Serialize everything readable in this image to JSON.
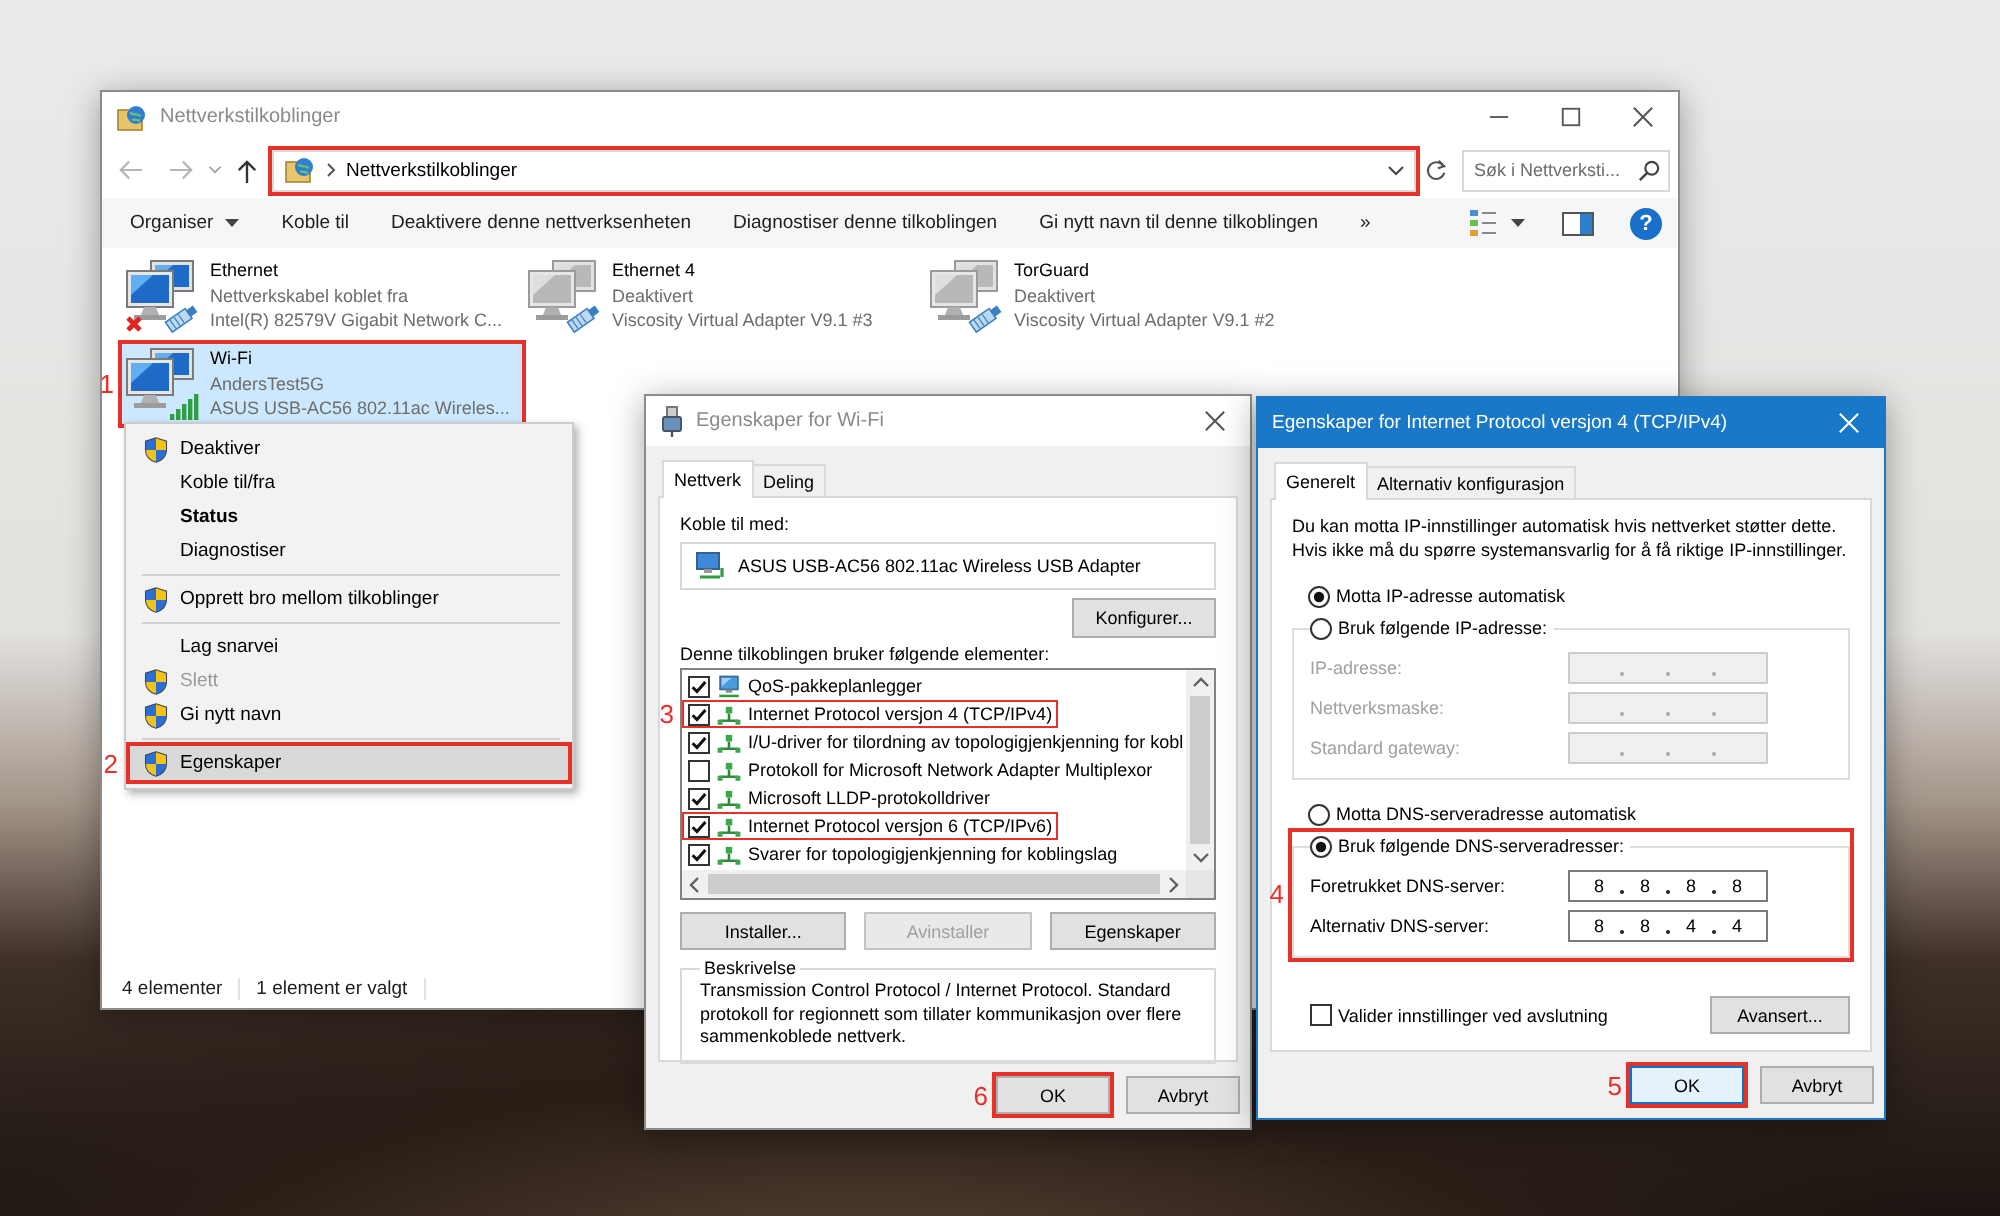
{
  "explorer": {
    "title": "Nettverkstilkoblinger",
    "active": false,
    "address": {
      "path": "Nettverkstilkoblinger",
      "highlighted": true
    },
    "search": {
      "placeholder": "Søk i Nettverksti..."
    },
    "toolbar": [
      {
        "label": "Organiser",
        "kind": "menu"
      },
      {
        "label": "Koble til",
        "kind": "command"
      },
      {
        "label": "Deaktivere denne nettverksenheten",
        "kind": "command"
      },
      {
        "label": "Diagnostiser denne tilkoblingen",
        "kind": "command"
      },
      {
        "label": "Gi nytt navn til denne tilkoblingen",
        "kind": "command"
      },
      {
        "label": "»",
        "kind": "command"
      }
    ],
    "help": "?",
    "connections": [
      {
        "name": "Ethernet",
        "status": "Nettverkskabel koblet fra",
        "device": "Intel(R) 82579V Gigabit Network C...",
        "kind": "wired",
        "disabled": false,
        "unplugged": true,
        "selected": false,
        "highlighted": false
      },
      {
        "name": "Ethernet 4",
        "status": "Deaktivert",
        "device": "Viscosity Virtual Adapter V9.1 #3",
        "kind": "wired",
        "disabled": true,
        "unplugged": false,
        "selected": false,
        "highlighted": false
      },
      {
        "name": "TorGuard",
        "status": "Deaktivert",
        "device": "Viscosity Virtual Adapter V9.1 #2",
        "kind": "wired",
        "disabled": true,
        "unplugged": false,
        "selected": false,
        "highlighted": false
      },
      {
        "name": "Wi-Fi",
        "status": "AndersTest5G",
        "device": "ASUS USB-AC56 802.11ac Wireles...",
        "kind": "wireless",
        "disabled": false,
        "unplugged": false,
        "selected": true,
        "highlighted": true,
        "step": "1"
      }
    ],
    "status_bar": [
      "4 elementer",
      "1 element er valgt"
    ]
  },
  "context_menu": {
    "items": [
      {
        "kind": "item",
        "label": "Deaktiver",
        "shield": true,
        "default": false,
        "disabled": false,
        "selected": false,
        "highlighted": false
      },
      {
        "kind": "item",
        "label": "Koble til/fra",
        "shield": false,
        "default": false,
        "disabled": false,
        "selected": false,
        "highlighted": false
      },
      {
        "kind": "item",
        "label": "Status",
        "shield": false,
        "default": true,
        "disabled": false,
        "selected": false,
        "highlighted": false
      },
      {
        "kind": "item",
        "label": "Diagnostiser",
        "shield": false,
        "default": false,
        "disabled": false,
        "selected": false,
        "highlighted": false
      },
      {
        "kind": "separator"
      },
      {
        "kind": "item",
        "label": "Opprett bro mellom tilkoblinger",
        "shield": true,
        "default": false,
        "disabled": false,
        "selected": false,
        "highlighted": false
      },
      {
        "kind": "separator"
      },
      {
        "kind": "item",
        "label": "Lag snarvei",
        "shield": false,
        "default": false,
        "disabled": false,
        "selected": false,
        "highlighted": false
      },
      {
        "kind": "item",
        "label": "Slett",
        "shield": true,
        "default": false,
        "disabled": true,
        "selected": false,
        "highlighted": false
      },
      {
        "kind": "item",
        "label": "Gi nytt navn",
        "shield": true,
        "default": false,
        "disabled": false,
        "selected": false,
        "highlighted": false
      },
      {
        "kind": "separator"
      },
      {
        "kind": "item",
        "label": "Egenskaper",
        "shield": true,
        "default": false,
        "disabled": false,
        "selected": true,
        "highlighted": true,
        "step": "2"
      }
    ]
  },
  "wifi_dialog": {
    "title": "Egenskaper for Wi-Fi",
    "active": false,
    "tabs": [
      {
        "label": "Nettverk",
        "selected": true
      },
      {
        "label": "Deling",
        "selected": false
      }
    ],
    "connect_label": "Koble til med:",
    "adapter": "ASUS USB-AC56 802.11ac Wireless USB Adapter",
    "configure_button": "Konfigurer...",
    "items_label": "Denne tilkoblingen bruker følgende elementer:",
    "items": [
      {
        "label": "QoS-pakkeplanlegger",
        "kind": "service",
        "checked": true,
        "highlighted": false
      },
      {
        "label": "Internet Protocol versjon 4 (TCP/IPv4)",
        "kind": "protocol",
        "checked": true,
        "highlighted": true,
        "step": "3"
      },
      {
        "label": "I/U-driver for tilordning av topologigjenkjenning for kobl",
        "kind": "protocol",
        "checked": true,
        "highlighted": false
      },
      {
        "label": "Protokoll for Microsoft Network Adapter Multiplexor",
        "kind": "protocol",
        "checked": false,
        "highlighted": false
      },
      {
        "label": "Microsoft LLDP-protokolldriver",
        "kind": "protocol",
        "checked": true,
        "highlighted": false
      },
      {
        "label": "Internet Protocol versjon 6 (TCP/IPv6)",
        "kind": "protocol",
        "checked": true,
        "highlighted": true
      },
      {
        "label": "Svarer for topologigjenkjenning for koblingslag",
        "kind": "protocol",
        "checked": true,
        "highlighted": false
      }
    ],
    "item_buttons": [
      {
        "label": "Installer...",
        "disabled": false
      },
      {
        "label": "Avinstaller",
        "disabled": true
      },
      {
        "label": "Egenskaper",
        "disabled": false
      }
    ],
    "description": {
      "title": "Beskrivelse",
      "text": "Transmission Control Protocol / Internet Protocol. Standard protokoll for regionnett som tillater kommunikasjon over flere sammenkoblede nettverk."
    },
    "buttons": [
      {
        "label": "OK",
        "focused": false,
        "highlighted": true,
        "step": "6"
      },
      {
        "label": "Avbryt",
        "focused": false,
        "highlighted": false
      }
    ]
  },
  "ipv4_dialog": {
    "title": "Egenskaper for Internet Protocol versjon 4 (TCP/IPv4)",
    "active": true,
    "tabs": [
      {
        "label": "Generelt",
        "selected": true
      },
      {
        "label": "Alternativ konfigurasjon",
        "selected": false
      }
    ],
    "intro": "Du kan motta IP-innstillinger automatisk hvis nettverket støtter dette. Hvis ikke må du spørre systemansvarlig for å få riktige IP-innstillinger.",
    "ip_options": [
      {
        "label": "Motta IP-adresse automatisk",
        "selected": true
      },
      {
        "label": "Bruk følgende IP-adresse:",
        "selected": false
      }
    ],
    "ip_fields": [
      {
        "label": "IP-adresse:",
        "disabled": true
      },
      {
        "label": "Nettverksmaske:",
        "disabled": true
      },
      {
        "label": "Standard gateway:",
        "disabled": true
      }
    ],
    "dns_options": [
      {
        "label": "Motta DNS-serveradresse automatisk",
        "selected": false
      },
      {
        "label": "Bruk følgende DNS-serveradresser:",
        "selected": true
      }
    ],
    "dns_group": {
      "highlighted": true,
      "step": "4"
    },
    "dns_fields": [
      {
        "label": "Foretrukket DNS-server:",
        "octets": [
          "8",
          "8",
          "8",
          "8"
        ],
        "disabled": false
      },
      {
        "label": "Alternativ DNS-server:",
        "octets": [
          "8",
          "8",
          "4",
          "4"
        ],
        "disabled": false
      }
    ],
    "validate": {
      "label": "Valider innstillinger ved avslutning",
      "checked": false
    },
    "advanced_button": "Avansert...",
    "buttons": [
      {
        "label": "OK",
        "focused": true,
        "highlighted": true,
        "step": "5"
      },
      {
        "label": "Avbryt",
        "focused": false,
        "highlighted": false
      }
    ]
  }
}
